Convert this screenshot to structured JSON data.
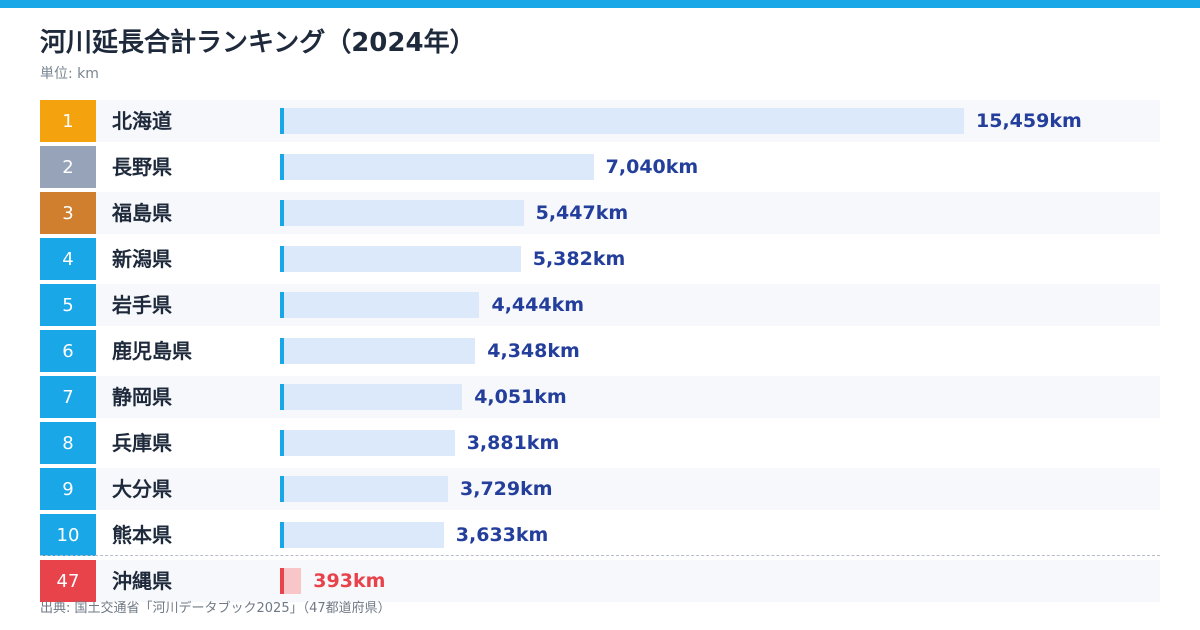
{
  "title": "河川延長合計ランキング（2024年）",
  "subtitle": "単位: km",
  "source": "出典: 国土交通省「河川データブック2025」（47都道府県）",
  "colors": {
    "accent": "#1aa7e8",
    "gold": "#f5a20f",
    "silver": "#97a3b8",
    "bronze": "#d07f2f",
    "rank_default": "#1aa7e8",
    "last": "#e8424b",
    "bar": "#dbe9fb",
    "bar_last": "#f8c6c8",
    "value_text": "#243e9c"
  },
  "chart_data": {
    "type": "bar",
    "orientation": "horizontal",
    "title": "河川延長合計ランキング（2024年）",
    "unit": "km",
    "xlim": [
      0,
      15459
    ],
    "categories": [
      "北海道",
      "長野県",
      "福島県",
      "新潟県",
      "岩手県",
      "鹿児島県",
      "静岡県",
      "兵庫県",
      "大分県",
      "熊本県",
      "沖縄県"
    ],
    "ranks": [
      "1",
      "2",
      "3",
      "4",
      "5",
      "6",
      "7",
      "8",
      "9",
      "10",
      "47"
    ],
    "values": [
      15459,
      7040,
      5447,
      5382,
      4444,
      4348,
      4051,
      3881,
      3729,
      3633,
      393
    ],
    "labels": [
      "15,459km",
      "7,040km",
      "5,447km",
      "5,382km",
      "4,444km",
      "4,348km",
      "4,051km",
      "3,881km",
      "3,729km",
      "3,633km",
      "393km"
    ]
  }
}
